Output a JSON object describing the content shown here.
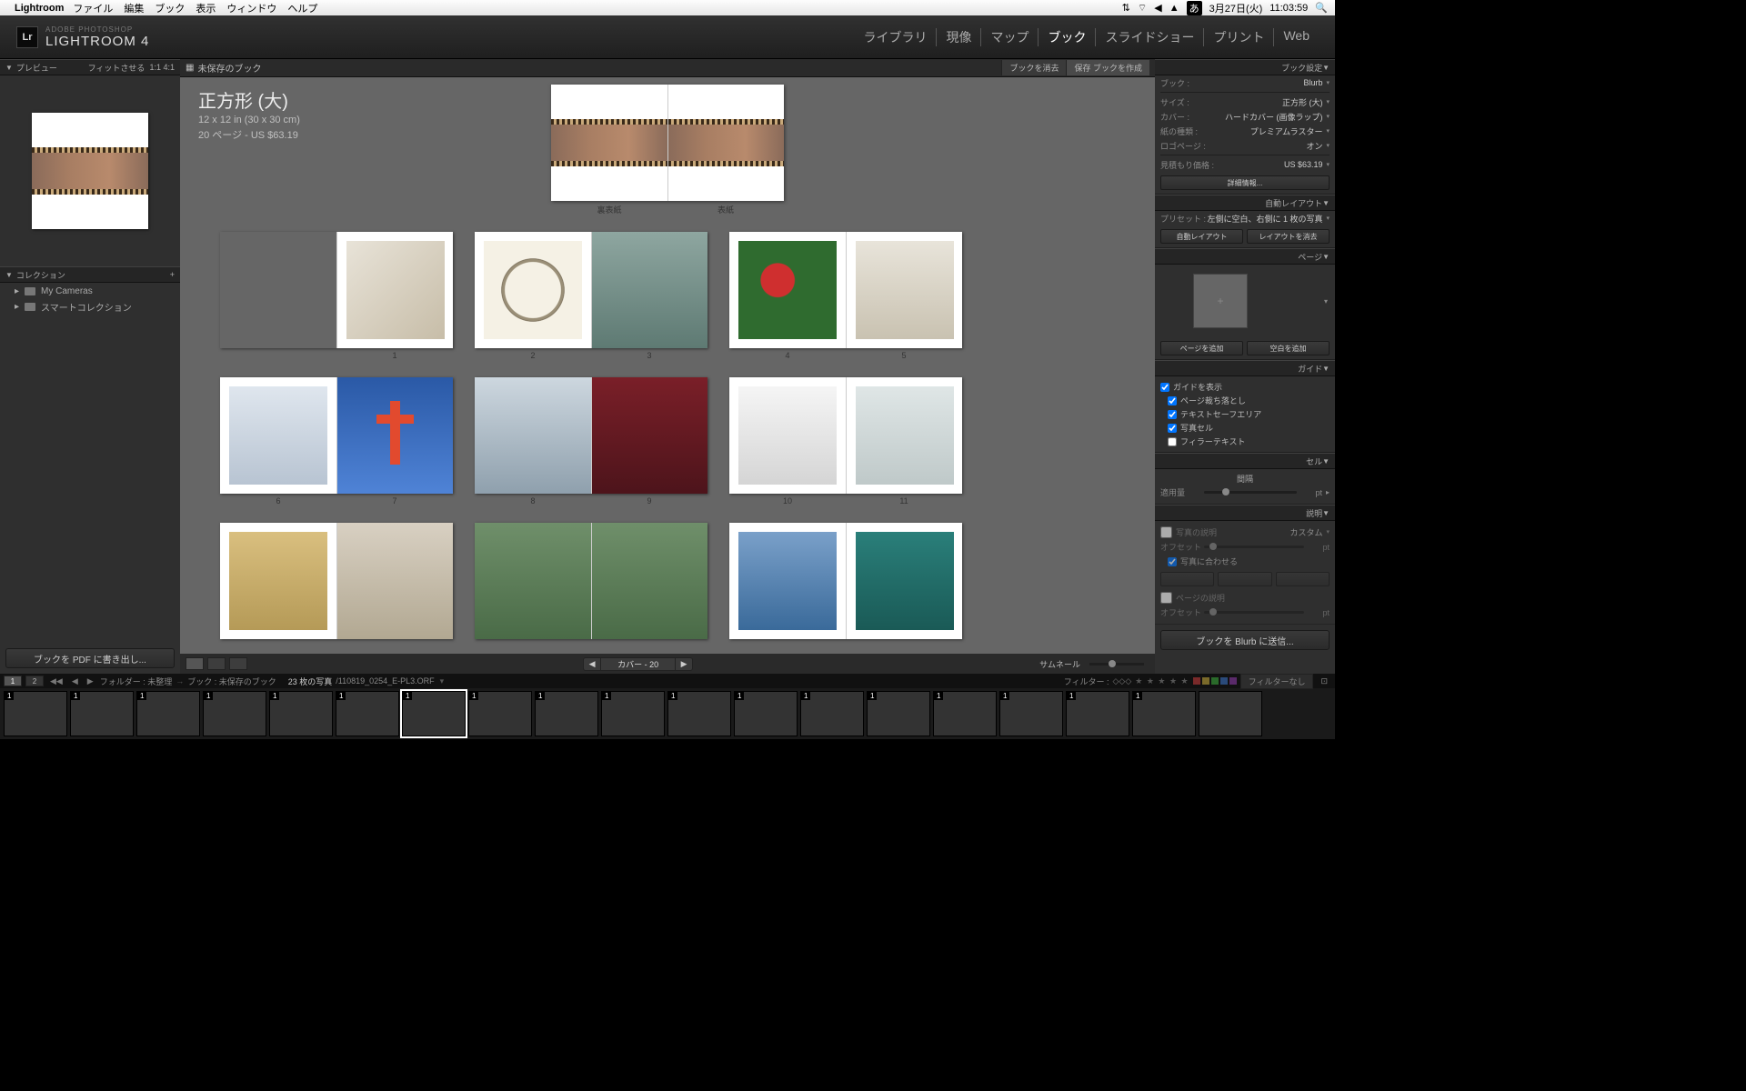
{
  "macMenu": {
    "appName": "Lightroom",
    "items": [
      "ファイル",
      "編集",
      "ブック",
      "表示",
      "ウィンドウ",
      "ヘルプ"
    ],
    "ime": "あ",
    "date": "3月27日(火)",
    "time": "11:03:59"
  },
  "identity": {
    "logo": "Lr",
    "sub": "ADOBE PHOTOSHOP",
    "main": "LIGHTROOM 4"
  },
  "modules": {
    "items": [
      "ライブラリ",
      "現像",
      "マップ",
      "ブック",
      "スライドショー",
      "プリント",
      "Web"
    ],
    "active": "ブック"
  },
  "leftPanel": {
    "previewTitle": "プレビュー",
    "fit": "フィットさせる",
    "r1": "1:1",
    "r2": "4:1",
    "collectionsTitle": "コレクション",
    "plus": "+",
    "collections": [
      "My Cameras",
      "スマートコレクション"
    ],
    "exportBtn": "ブックを PDF に書き出し..."
  },
  "centerTop": {
    "title": "未保存のブック",
    "clearBtn": "ブックを消去",
    "saveBtn": "保存 ブックを作成"
  },
  "bookInfo": {
    "title": "正方形 (大)",
    "size": "12 x 12 in (30 x 30 cm)",
    "pages": "20 ページ - US $63.19"
  },
  "coverLabels": {
    "back": "裏表紙",
    "front": "表紙"
  },
  "pageNumbers": [
    "1",
    "2",
    "3",
    "4",
    "5",
    "6",
    "7",
    "8",
    "9",
    "10",
    "11"
  ],
  "centerToolbar": {
    "pagerLabel": "カバー - 20",
    "thumbLabel": "サムネール"
  },
  "rightPanel": {
    "bookSettingsTitle": "ブック設定",
    "book": {
      "k": "ブック :",
      "v": "Blurb"
    },
    "size": {
      "k": "サイズ :",
      "v": "正方形 (大)"
    },
    "cover": {
      "k": "カバー :",
      "v": "ハードカバー (画像ラップ)"
    },
    "paper": {
      "k": "紙の種類 :",
      "v": "プレミアムラスター"
    },
    "logoPage": {
      "k": "ロゴページ :",
      "v": "オン"
    },
    "estimate": {
      "k": "見積もり価格 :",
      "v": "US $63.19"
    },
    "detailBtn": "詳細情報...",
    "autoLayoutTitle": "自動レイアウト",
    "preset": {
      "k": "プリセット :",
      "v": "左側に空白、右側に 1 枚の写真"
    },
    "autoLayoutBtn": "自動レイアウト",
    "clearLayoutBtn": "レイアウトを消去",
    "pageTitle": "ページ",
    "addPageBtn": "ページを追加",
    "addBlankBtn": "空白を追加",
    "guidesTitle": "ガイド",
    "showGuides": "ガイドを表示",
    "guideChecks": [
      "ページ裁ち落とし",
      "テキストセーフエリア",
      "写真セル",
      "フィラーテキスト"
    ],
    "guideChecked": [
      true,
      true,
      true,
      false
    ],
    "cellTitle": "セル",
    "cellPadding": "間隔",
    "cellApply": "適用量",
    "cellUnit": "pt",
    "captionTitle": "説明",
    "photoCaption": "写真の説明",
    "custom": "カスタム",
    "offset": "オフセット",
    "fitPhoto": "写真に合わせる",
    "pageCaption": "ページの説明",
    "offsetUnit": "pt",
    "sendBtn": "ブックを Blurb に送信..."
  },
  "infoBar": {
    "nav1": "1",
    "nav2": "2",
    "path1": "フォルダー : 未整理",
    "path2": "ブック : 未保存のブック",
    "count": "23 枚の写真",
    "file": "/110819_0254_E-PL3.ORF",
    "filterLabel": "フィルター :",
    "filterNone": "フィルターなし"
  },
  "filmBadges": [
    "1",
    "1",
    "1",
    "1",
    "1",
    "1",
    "1",
    "1",
    "1",
    "1",
    "1",
    "1",
    "1",
    "1",
    "1",
    "1",
    "1",
    "1"
  ]
}
